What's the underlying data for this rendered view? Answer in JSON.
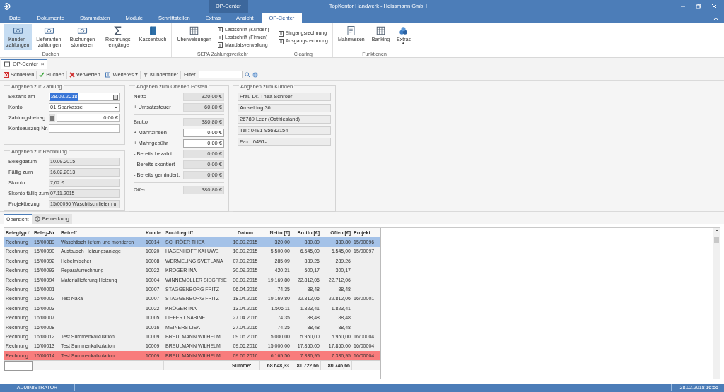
{
  "window": {
    "title": "TopKontor Handwerk - Heissmann GmbH",
    "context_tab": "OP-Center"
  },
  "menu_tabs": [
    {
      "label": "Datei",
      "selected": false
    },
    {
      "label": "Dokumente",
      "selected": false
    },
    {
      "label": "Stammdaten",
      "selected": false
    },
    {
      "label": "Module",
      "selected": false
    },
    {
      "label": "Schnittstellen",
      "selected": false
    },
    {
      "label": "Extras",
      "selected": false
    },
    {
      "label": "Ansicht",
      "selected": false
    },
    {
      "label": "OP-Center",
      "selected": true
    }
  ],
  "ribbon_groups": [
    {
      "label": "Buchen",
      "items": [
        {
          "kind": "large",
          "label": "Kunden-\nzahlungen",
          "selected": true
        },
        {
          "kind": "large",
          "label": "Lieferanten-\nzahlungen",
          "selected": false
        },
        {
          "kind": "large",
          "label": "Buchungen\nstornieren",
          "selected": false
        }
      ]
    },
    {
      "items": [
        {
          "kind": "large",
          "label": "Rechnungs-\neingänge",
          "selected": false
        },
        {
          "kind": "large",
          "label": "Kassenbuch",
          "selected": false
        }
      ]
    },
    {
      "label": "SEPA Zahlungsverkehr",
      "items": [
        {
          "kind": "large",
          "label": "Überweisungen",
          "selected": false
        },
        {
          "kind": "small",
          "label": "Lastschrift (Kunden)",
          "selected": false
        },
        {
          "kind": "small",
          "label": "Lastschrift (Firmen)",
          "selected": false
        },
        {
          "kind": "small",
          "label": "Mandatsverwaltung",
          "selected": false
        }
      ]
    },
    {
      "label": "Clearing",
      "items": [
        {
          "kind": "small",
          "label": "Eingangsrechnung",
          "selected": false
        },
        {
          "kind": "small",
          "label": "Ausgangsrechnung",
          "selected": false
        }
      ]
    },
    {
      "label": "Funktionen",
      "items": [
        {
          "kind": "large",
          "label": "Mahnwesen",
          "selected": false
        },
        {
          "kind": "large",
          "label": "Banking",
          "selected": false
        },
        {
          "kind": "menu",
          "label": "Extras",
          "selected": false
        }
      ]
    }
  ],
  "doc_tab": {
    "label": "OP-Center",
    "close": "×"
  },
  "toolbar": [
    {
      "kind": "close",
      "label": "Schließen"
    },
    {
      "kind": "check",
      "label": "Buchen"
    },
    {
      "kind": "discard",
      "label": "Verwerfen"
    },
    {
      "kind": "menu",
      "label": "Weiteres"
    },
    {
      "kind": "filter",
      "label": "Kundenfilter"
    }
  ],
  "filter": {
    "label": "Filter"
  },
  "payment": {
    "title": "Angaben zur Zahlung",
    "fields": [
      {
        "kind": "date",
        "label": "Bezahlt am",
        "value": "28.02.2018"
      },
      {
        "kind": "select",
        "label": "Konto",
        "value": "01 Sparkasse"
      },
      {
        "kind": "amount",
        "label": "Zahlungsbetrag",
        "value": "0,00 €"
      },
      {
        "kind": "text",
        "label": "Kontoauszug-Nr."
      }
    ]
  },
  "invoice": {
    "title": "Angaben zur Rechnung",
    "fields": [
      {
        "label": "Belegdatum",
        "value": "10.09.2015"
      },
      {
        "label": "Fällig zum",
        "value": "16.02.2013"
      },
      {
        "label": "Skonto",
        "value": "7,62 €"
      },
      {
        "label": "Skonto fällig zum",
        "value": "07.11.2015"
      },
      {
        "label": "Projektbezug",
        "value": "15/00096 Waschtisch liefern u"
      }
    ]
  },
  "open_item": {
    "title": "Angaben zum Offenen Posten",
    "sections": [
      [
        {
          "label": "Netto",
          "value": "320,00 €",
          "editable": false
        },
        {
          "label": "+ Umsatzsteuer",
          "value": "60,80 €",
          "editable": false
        }
      ],
      [
        {
          "label": "Brutto",
          "value": "380,80 €",
          "editable": false
        },
        {
          "label": "+ Mahnzinsen",
          "value": "0,00 €",
          "editable": true
        },
        {
          "label": "+ Mahngebühr",
          "value": "0,00 €",
          "editable": true
        },
        {
          "label": "- Bereits bezahlt",
          "value": "0,00 €",
          "editable": false
        },
        {
          "label": "- Bereits skontiert",
          "value": "0,00 €",
          "editable": false
        },
        {
          "label": "- Bereits gemindert:",
          "value": "0,00 €",
          "editable": false
        }
      ],
      [
        {
          "label": "Offen",
          "value": "380,80 €",
          "editable": false
        }
      ]
    ]
  },
  "customer": {
    "title": "Angaben zum Kunden",
    "lines": [
      "Frau Dr. Thea Schröer",
      "Amselring 36",
      "26789 Leer (Ostfriesland)",
      "Tel.: 0491-95632154",
      "Fax.: 0491-"
    ]
  },
  "detail_tabs": [
    {
      "label": "Übersicht",
      "selected": true
    },
    {
      "label": "Bemerkung",
      "selected": false
    }
  ],
  "table": {
    "columns": [
      {
        "label": "Belegtyp",
        "sort": "/"
      },
      {
        "label": "Beleg-Nr."
      },
      {
        "label": "Betreff"
      },
      {
        "label": "Kunde"
      },
      {
        "label": "Suchbegriff"
      },
      {
        "label": "Datum"
      },
      {
        "label": "Netto [€]"
      },
      {
        "label": "Brutto [€]"
      },
      {
        "label": "Offen [€]"
      },
      {
        "label": "Projekt"
      }
    ],
    "rows": [
      {
        "selected": true,
        "flagged": false,
        "cells": [
          "Rechnung",
          "15/00089",
          "Waschtisch liefern und montieren",
          "10014",
          "SCHRÖER THEA",
          "10.09.2015",
          "320,00",
          "380,80",
          "380,80",
          "15/00096"
        ]
      },
      {
        "selected": false,
        "flagged": false,
        "cells": [
          "Rechnung",
          "15/00090",
          "Austausch Heizungsanlage",
          "10020",
          "HAGENHOFF KAI UWE",
          "10.09.2015",
          "5.500,00",
          "6.545,00",
          "6.545,00",
          "15/00097"
        ]
      },
      {
        "selected": false,
        "flagged": false,
        "cells": [
          "Rechnung",
          "15/00092",
          "Hebelmischer",
          "10008",
          "WERMELING SVETLANA",
          "07.09.2015",
          "285,09",
          "339,26",
          "289,26",
          ""
        ]
      },
      {
        "selected": false,
        "flagged": false,
        "cells": [
          "Rechnung",
          "15/00093",
          "Reparaturrechnung",
          "10022",
          "KRÖGER INA",
          "30.09.2015",
          "420,31",
          "500,17",
          "300,17",
          ""
        ]
      },
      {
        "selected": false,
        "flagged": false,
        "cells": [
          "Rechnung",
          "15/00094",
          "Materiallieferung Heizung",
          "10004",
          "WINNEMÖLLER SIEGFRIE",
          "30.09.2015",
          "19.169,80",
          "22.812,06",
          "22.712,06",
          ""
        ]
      },
      {
        "selected": false,
        "flagged": false,
        "cells": [
          "Rechnung",
          "16/00001",
          "",
          "10007",
          "STAGGENBORG FRITZ",
          "06.04.2016",
          "74,35",
          "88,48",
          "88,48",
          ""
        ]
      },
      {
        "selected": false,
        "flagged": false,
        "cells": [
          "Rechnung",
          "16/00002",
          "Test Naka",
          "10007",
          "STAGGENBORG FRITZ",
          "18.04.2016",
          "19.169,80",
          "22.812,06",
          "22.812,06",
          "16/00001"
        ]
      },
      {
        "selected": false,
        "flagged": false,
        "cells": [
          "Rechnung",
          "16/00003",
          "",
          "10022",
          "KRÖGER INA",
          "13.04.2016",
          "1.506,11",
          "1.823,41",
          "1.823,41",
          ""
        ]
      },
      {
        "selected": false,
        "flagged": false,
        "cells": [
          "Rechnung",
          "16/00007",
          "",
          "10005",
          "LIEFERT SABINE",
          "27.04.2016",
          "74,35",
          "88,48",
          "88,48",
          ""
        ]
      },
      {
        "selected": false,
        "flagged": false,
        "cells": [
          "Rechnung",
          "16/00008",
          "",
          "10016",
          "MEINERS LISA",
          "27.04.2016",
          "74,35",
          "88,48",
          "88,48",
          ""
        ]
      },
      {
        "selected": false,
        "flagged": false,
        "cells": [
          "Rechnung",
          "16/00012",
          "Test Summenkalkulation",
          "10009",
          "BREULMANN WILHELM",
          "09.06.2016",
          "5.000,00",
          "5.950,00",
          "5.950,00",
          "16/00004"
        ]
      },
      {
        "selected": false,
        "flagged": false,
        "cells": [
          "Rechnung",
          "16/00013",
          "Test Summenkalkulation",
          "10009",
          "BREULMANN WILHELM",
          "09.06.2016",
          "15.000,00",
          "17.850,00",
          "17.850,00",
          "16/00004"
        ]
      },
      {
        "selected": false,
        "flagged": true,
        "cells": [
          "Rechnung",
          "16/00014",
          "Test Summenkalkulation",
          "10009",
          "BREULMANN WILHELM",
          "09.06.2016",
          "6.165,50",
          "7.336,95",
          "7.336,95",
          "16/00004"
        ]
      }
    ],
    "totals": {
      "label": "Summe:",
      "values": [
        "68.648,33",
        "81.722,66",
        "80.746,66"
      ]
    }
  },
  "status_bar": {
    "user": "ADMINISTRATOR",
    "datetime": "28.02.2018 16:55"
  }
}
